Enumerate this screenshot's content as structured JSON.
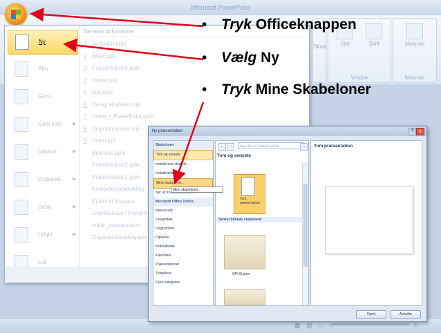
{
  "app": {
    "window_title": "Microsoft PowerPoint",
    "ribbon_labels": [
      "Skala",
      "Slet",
      "Skift",
      "Makroer",
      "Vindue",
      "Makroer"
    ]
  },
  "office_menu": {
    "items": [
      {
        "label": "Ny",
        "icon": "new-document-icon",
        "has_arrow": false
      },
      {
        "label": "Åbn",
        "icon": "folder-icon",
        "has_arrow": false
      },
      {
        "label": "Gem",
        "icon": "save-icon",
        "has_arrow": false
      },
      {
        "label": "Gem som",
        "icon": "save-as-icon",
        "has_arrow": true
      },
      {
        "label": "Udskriv",
        "icon": "printer-icon",
        "has_arrow": true
      },
      {
        "label": "Forbered",
        "icon": "prepare-icon",
        "has_arrow": true
      },
      {
        "label": "Send",
        "icon": "send-icon",
        "has_arrow": true
      },
      {
        "label": "Udgiv",
        "icon": "publish-icon",
        "has_arrow": true
      },
      {
        "label": "Luk",
        "icon": "close-doc-icon",
        "has_arrow": false
      }
    ],
    "recent_header": "Seneste dokumenter",
    "recent": [
      {
        "n": "1",
        "name": "skabelon.pptx"
      },
      {
        "n": "2",
        "name": "Wahl.pptx"
      },
      {
        "n": "3",
        "name": "Præsentation5.pptx"
      },
      {
        "n": "4",
        "name": "Hvaler.pot"
      },
      {
        "n": "5",
        "name": "test.potx"
      },
      {
        "n": "6",
        "name": "Designskabelon.ppt"
      },
      {
        "n": "7",
        "name": "Video_i_PowerPoint.pptx"
      },
      {
        "n": "8",
        "name": "Dispositionsvisning"
      },
      {
        "n": "9",
        "name": "Video.ppt"
      },
      {
        "n": "",
        "name": "Blomster.pptx"
      },
      {
        "n": "",
        "name": "Præsentation2.pptx"
      },
      {
        "n": "",
        "name": "Præsentation1.pptx"
      },
      {
        "n": "",
        "name": "Kompetenceudvikling"
      },
      {
        "n": "",
        "name": "Ej blot til lyst.pptx"
      },
      {
        "n": "",
        "name": "Grundkursus i PowerPoint"
      },
      {
        "n": "",
        "name": "enkle_præsentation"
      },
      {
        "n": "",
        "name": "Organisationsdiagram"
      }
    ]
  },
  "dialog": {
    "title": "Ny præsentation",
    "help": "?",
    "close": "x",
    "sidebar": [
      {
        "label": "Skabeloner",
        "kind": "header"
      },
      {
        "label": "Tom og seneste",
        "kind": "selected"
      },
      {
        "label": "Installerede skabelo...",
        "kind": "item"
      },
      {
        "label": "Installerede temaer",
        "kind": "item"
      },
      {
        "label": "Mine skabeloner...",
        "kind": "hover"
      },
      {
        "label": "Nyt ud fra eksisterende...",
        "kind": "item"
      },
      {
        "label": "Microsoft Office Online",
        "kind": "header"
      },
      {
        "label": "Interessant",
        "kind": "item"
      },
      {
        "label": "Designdias",
        "kind": "item"
      },
      {
        "label": "Diagrammer",
        "kind": "item"
      },
      {
        "label": "Diplomer",
        "kind": "item"
      },
      {
        "label": "Indholdsdias",
        "kind": "item"
      },
      {
        "label": "Kalendere",
        "kind": "item"
      },
      {
        "label": "Præsentationer",
        "kind": "item"
      },
      {
        "label": "Tidsplaner",
        "kind": "item"
      },
      {
        "label": "Flere kategorier",
        "kind": "item"
      }
    ],
    "search_placeholder": "Søg efter en skabelon på Mi",
    "nav_back": "←",
    "nav_forward": "→",
    "search_go": "→",
    "section_title": "Tom og seneste",
    "blank_caption": "Tom præsentation",
    "recent_section": "Senest åbnede skabeloner",
    "template_caption": "OPUS.potx",
    "preview_title": "Tom præsentation",
    "tooltip": "Mine skabeloner...",
    "ok_label": "Opret",
    "cancel_label": "Annuller"
  },
  "annotations": [
    {
      "bullet": "•",
      "verb": "Tryk",
      "rest": " Officeknappen"
    },
    {
      "bullet": "•",
      "verb": "Vælg",
      "rest": " Ny"
    },
    {
      "bullet": "•",
      "verb": "Tryk",
      "rest": " Mine Skabeloner"
    }
  ],
  "colors": {
    "arrow": "#e0001b",
    "highlight": "#ffd766",
    "accent": "#1d3558"
  }
}
